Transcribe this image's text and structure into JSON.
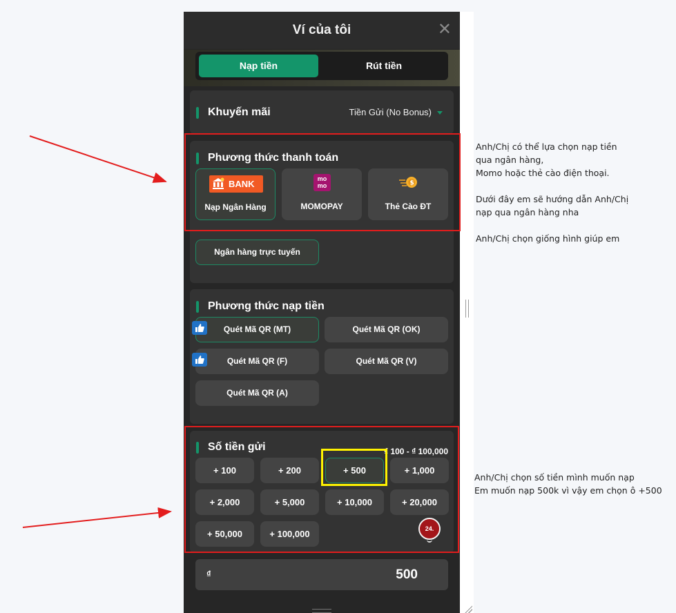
{
  "wallet": {
    "title": "Ví của tôi",
    "close_symbol": "✕",
    "tabs": [
      {
        "label": "Nạp tiền",
        "active": true
      },
      {
        "label": "Rút tiền",
        "active": false
      }
    ],
    "promo": {
      "label": "Khuyến mãi",
      "selected": "Tiền Gửi (No Bonus)"
    },
    "payment_methods": {
      "title": "Phương thức thanh toán",
      "items": [
        {
          "label": "Nạp Ngân Hàng",
          "logo_text": "BANK",
          "icon": "bank-icon",
          "selected": true
        },
        {
          "label": "MOMOPAY",
          "logo_text_top": "mo",
          "logo_text_bottom": "mo",
          "icon": "momo-icon",
          "selected": false
        },
        {
          "label": "Thẻ Cào ĐT",
          "icon": "scratch-card-icon",
          "selected": false
        }
      ],
      "sub_option": "Ngân hàng trực tuyến"
    },
    "deposit_methods": {
      "title": "Phương thức nạp tiền",
      "items": [
        {
          "label": "Quét Mã QR (MT)",
          "recommended": true,
          "selected": true
        },
        {
          "label": "Quét Mã QR (OK)",
          "recommended": false,
          "selected": false
        },
        {
          "label": "Quét Mã QR (F)",
          "recommended": true,
          "selected": false
        },
        {
          "label": "Quét Mã QR (V)",
          "recommended": false,
          "selected": false
        },
        {
          "label": "Quét Mã QR (A)",
          "recommended": false,
          "selected": false
        }
      ]
    },
    "amount": {
      "title": "Số tiền gửi",
      "range": "₫ 100 - ₫ 100,000",
      "options": [
        "+ 100",
        "+ 200",
        "+ 500",
        "+ 1,000",
        "+ 2,000",
        "+ 5,000",
        "+ 10,000",
        "+ 20,000",
        "+ 50,000",
        "+ 100,000"
      ],
      "selected": "+ 500",
      "currency_symbol": "₫",
      "value": "500"
    },
    "support_badge": "24."
  },
  "annotations": {
    "note_1": "Anh/Chị có thể lựa chọn nạp tiền\nqua ngân hàng,\nMomo hoặc thẻ cào điện thoại.\n\nDưới đây em sẽ hướng dẫn Anh/Chị\nnạp qua ngân hàng nha\n\nAnh/Chị chọn giống hình giúp em",
    "note_2": "Anh/Chị chọn số tiền mình muốn nạp\nEm muốn nạp 500k vì vậy em chọn ô +500",
    "colors": {
      "highlight_red": "#e31d1d",
      "highlight_yellow": "#fff200",
      "accent_green": "#14956a"
    }
  }
}
